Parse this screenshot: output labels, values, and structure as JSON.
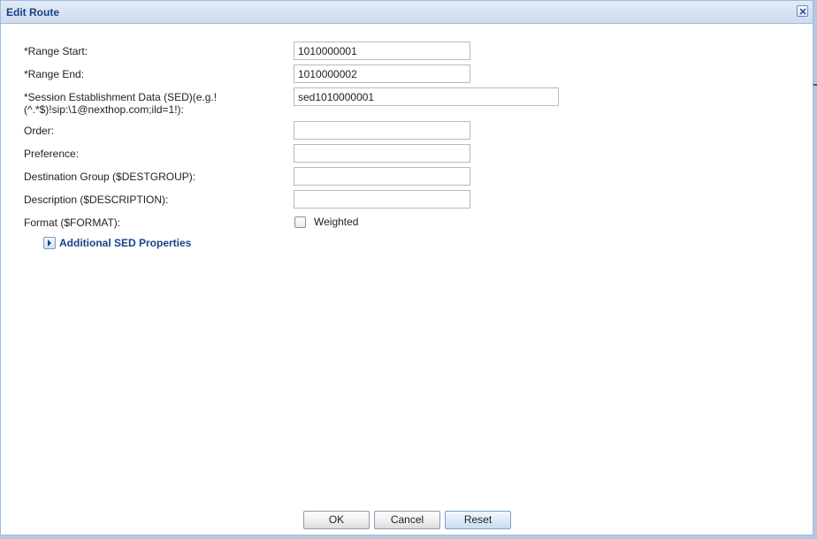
{
  "dialog": {
    "title": "Edit Route"
  },
  "form": {
    "range_start": {
      "label": "*Range Start:",
      "value": "1010000001"
    },
    "range_end": {
      "label": "*Range End:",
      "value": "1010000002"
    },
    "sed": {
      "label_line1": "*Session Establishment Data (SED)(e.g.!",
      "label_line2": "(^.*$)!sip:\\1@nexthop.com;ild=1!):",
      "value": "sed1010000001"
    },
    "order": {
      "label": "Order:",
      "value": ""
    },
    "preference": {
      "label": "Preference:",
      "value": ""
    },
    "destination_group": {
      "label": "Destination Group ($DESTGROUP):",
      "value": ""
    },
    "description": {
      "label": "Description ($DESCRIPTION):",
      "value": ""
    },
    "format": {
      "label": "Format ($FORMAT):",
      "checkbox_label": "Weighted",
      "checked": false
    }
  },
  "additional": {
    "label": "Additional SED Properties",
    "expanded": false
  },
  "buttons": {
    "ok": "OK",
    "cancel": "Cancel",
    "reset": "Reset"
  },
  "colors": {
    "title_text": "#15428b",
    "border": "#99bbe8",
    "background": "#ffffff"
  },
  "icons": {
    "close": "close-icon",
    "expander": "triangle-right-icon"
  }
}
